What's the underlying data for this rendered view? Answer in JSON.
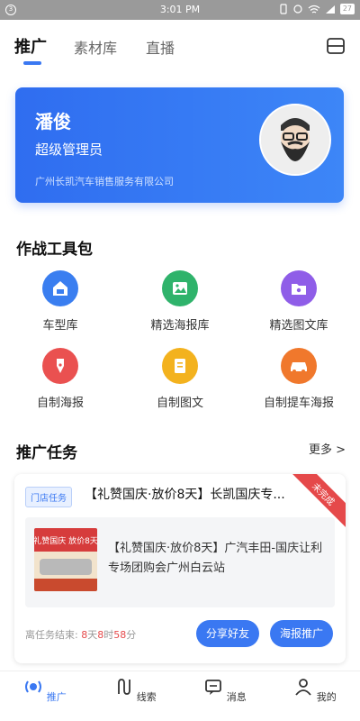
{
  "status_bar": {
    "left_badge": "3",
    "time": "3:01 PM",
    "battery": "27"
  },
  "top_tabs": [
    {
      "label": "推广",
      "active": true
    },
    {
      "label": "素材库",
      "active": false
    },
    {
      "label": "直播",
      "active": false
    }
  ],
  "profile": {
    "name": "潘俊",
    "role": "超级管理员",
    "company": "广州长凯汽车销售服务有限公司"
  },
  "toolkit": {
    "title": "作战工具包",
    "items": [
      {
        "label": "车型库",
        "icon": "car-garage-icon",
        "color": "#3a7ef0"
      },
      {
        "label": "精选海报库",
        "icon": "image-icon",
        "color": "#2fb36b"
      },
      {
        "label": "精选图文库",
        "icon": "folder-icon",
        "color": "#8f5de8"
      },
      {
        "label": "自制海报",
        "icon": "pen-nib-icon",
        "color": "#ea5150"
      },
      {
        "label": "自制图文",
        "icon": "document-icon",
        "color": "#f3b21e"
      },
      {
        "label": "自制提车海报",
        "icon": "car-icon",
        "color": "#f0782c"
      }
    ]
  },
  "tasks": {
    "title": "推广任务",
    "more_label": "更多 >",
    "card": {
      "tag": "门店任务",
      "title": "【礼赞国庆·放价8天】长凯国庆专...",
      "ribbon": "未完成",
      "content": "【礼赞国庆·放价8天】广汽丰田-国庆让利专场团购会广州白云站",
      "thumb_text": "礼赞国庆 放价8天",
      "deadline": {
        "prefix": "离任务结束:",
        "days": "8",
        "days_unit": "天",
        "hours": "8",
        "hours_unit": "时",
        "minutes": "58",
        "minutes_unit": "分"
      },
      "share_label": "分享好友",
      "poster_label": "海报推广"
    }
  },
  "bottom_nav": [
    {
      "label": "推广",
      "icon": "promote-icon",
      "active": true
    },
    {
      "label": "线索",
      "icon": "leads-icon",
      "active": false
    },
    {
      "label": "消息",
      "icon": "message-icon",
      "active": false
    },
    {
      "label": "我的",
      "icon": "profile-icon",
      "active": false
    }
  ],
  "colors": {
    "primary": "#3a78f2",
    "alert": "#e5494a"
  }
}
